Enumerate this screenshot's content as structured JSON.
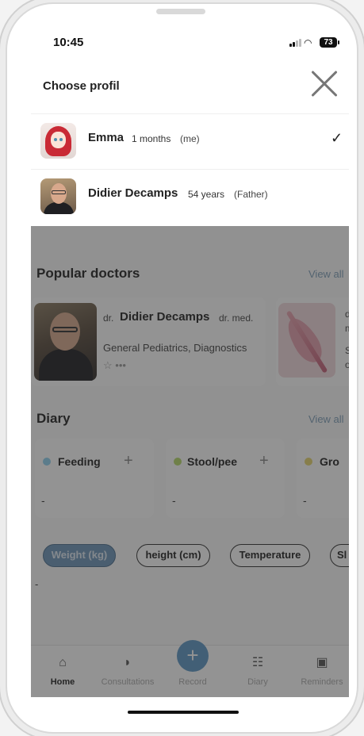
{
  "status_bar": {
    "time": "10:45",
    "battery": "73"
  },
  "profile_sheet": {
    "title": "Choose profil",
    "profiles": [
      {
        "name": "Emma",
        "age": "1 months",
        "relation": "(me)",
        "selected": true
      },
      {
        "name": "Didier Decamps",
        "age": "54 years",
        "relation": "(Father)",
        "selected": false
      }
    ]
  },
  "popular_doctors": {
    "title": "Popular doctors",
    "view_all": "View all",
    "doctor": {
      "prefix": "dr.",
      "name": "Didier Decamps",
      "suffix": "dr. med.",
      "specialty": "General Pediatrics, Diagnostics",
      "rating_icon": "star-icon"
    },
    "next_card_peek": {
      "line1": "dr",
      "line2": "m",
      "line3": "S",
      "line4": "ol"
    }
  },
  "diary": {
    "title": "Diary",
    "view_all": "View all",
    "cards": [
      {
        "label": "Feeding",
        "value": "-",
        "color": "#8fd0ee"
      },
      {
        "label": "Stool/pee",
        "value": "-",
        "color": "#b6d86a"
      },
      {
        "label": "Gro",
        "value": "-",
        "color": "#e6d56e"
      }
    ],
    "chips": [
      "Weight (kg)",
      "height (cm)",
      "Temperature",
      "Sl"
    ],
    "active_chip": "Weight (kg)",
    "chart_value": "-"
  },
  "tabbar": {
    "tabs": [
      {
        "label": "Home",
        "icon": "home-icon",
        "active": true
      },
      {
        "label": "Consultations",
        "icon": "consultations-icon",
        "active": false
      },
      {
        "label": "Record",
        "icon": "plus-icon",
        "active": false
      },
      {
        "label": "Diary",
        "icon": "diary-icon",
        "active": false
      },
      {
        "label": "Reminders",
        "icon": "reminders-icon",
        "active": false
      }
    ]
  }
}
